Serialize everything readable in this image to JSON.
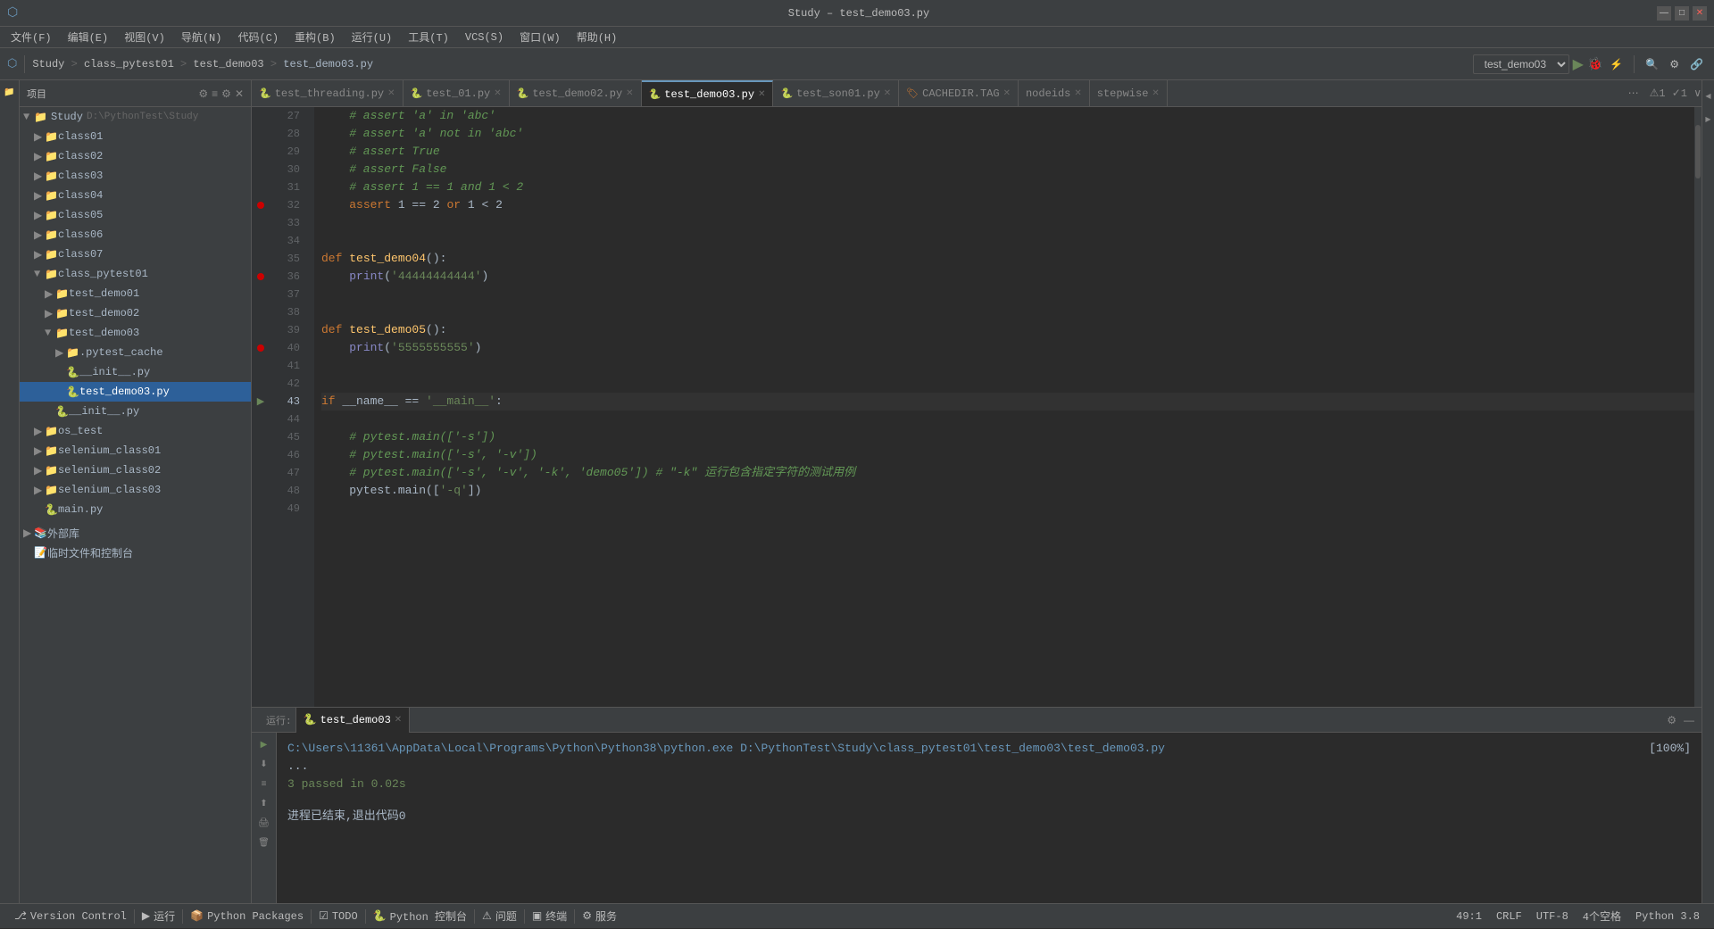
{
  "titlebar": {
    "title": "Study – test_demo03.py",
    "min": "—",
    "max": "□",
    "close": "✕"
  },
  "menubar": {
    "items": [
      "文件(F)",
      "编辑(E)",
      "视图(V)",
      "导航(N)",
      "代码(C)",
      "重构(B)",
      "运行(U)",
      "工具(T)",
      "VCS(S)",
      "窗口(W)",
      "帮助(H)"
    ]
  },
  "toolbar": {
    "project_label": "Study",
    "breadcrumb": [
      "Study",
      "class_pytest01",
      "test_demo03",
      "test_demo03.py"
    ],
    "run_config": "test_demo03",
    "run_label": "▶",
    "debug_label": "🐞"
  },
  "sidebar": {
    "header": "项目",
    "root": {
      "label": "Study",
      "path": "D:\\PythonTest\\Study"
    },
    "tree": [
      {
        "id": "class01",
        "label": "class01",
        "indent": 1,
        "type": "folder",
        "expanded": false
      },
      {
        "id": "class02",
        "label": "class02",
        "indent": 1,
        "type": "folder",
        "expanded": false
      },
      {
        "id": "class03",
        "label": "class03",
        "indent": 1,
        "type": "folder",
        "expanded": false
      },
      {
        "id": "class04",
        "label": "class04",
        "indent": 1,
        "type": "folder",
        "expanded": false
      },
      {
        "id": "class05",
        "label": "class05",
        "indent": 1,
        "type": "folder",
        "expanded": false
      },
      {
        "id": "class06",
        "label": "class06",
        "indent": 1,
        "type": "folder",
        "expanded": false
      },
      {
        "id": "class07",
        "label": "class07",
        "indent": 1,
        "type": "folder",
        "expanded": false
      },
      {
        "id": "class_pytest01",
        "label": "class_pytest01",
        "indent": 1,
        "type": "folder",
        "expanded": true
      },
      {
        "id": "test_demo01",
        "label": "test_demo01",
        "indent": 2,
        "type": "folder",
        "expanded": false
      },
      {
        "id": "test_demo02",
        "label": "test_demo02",
        "indent": 2,
        "type": "folder",
        "expanded": false
      },
      {
        "id": "test_demo03",
        "label": "test_demo03",
        "indent": 2,
        "type": "folder",
        "expanded": true
      },
      {
        "id": "pytest_cache",
        "label": ".pytest_cache",
        "indent": 3,
        "type": "folder",
        "expanded": false
      },
      {
        "id": "init_py",
        "label": "__init__.py",
        "indent": 3,
        "type": "py",
        "expanded": false
      },
      {
        "id": "test_demo03_py",
        "label": "test_demo03.py",
        "indent": 3,
        "type": "py",
        "expanded": false,
        "active": true
      },
      {
        "id": "init_py2",
        "label": "__init__.py",
        "indent": 2,
        "type": "py",
        "expanded": false
      },
      {
        "id": "os_test",
        "label": "os_test",
        "indent": 1,
        "type": "folder",
        "expanded": false
      },
      {
        "id": "selenium_class01",
        "label": "selenium_class01",
        "indent": 1,
        "type": "folder",
        "expanded": false
      },
      {
        "id": "selenium_class02",
        "label": "selenium_class02",
        "indent": 1,
        "type": "folder",
        "expanded": false
      },
      {
        "id": "selenium_class03",
        "label": "selenium_class03",
        "indent": 1,
        "type": "folder",
        "expanded": false
      },
      {
        "id": "main_py",
        "label": "main.py",
        "indent": 1,
        "type": "py",
        "expanded": false
      }
    ],
    "bottom": [
      {
        "id": "external",
        "label": "外部库",
        "icon": "📚"
      },
      {
        "id": "scratches",
        "label": "临时文件和控制台",
        "icon": "📝"
      }
    ]
  },
  "tabs": [
    {
      "id": "test_threading",
      "label": "test_threading.py",
      "active": false,
      "type": "py"
    },
    {
      "id": "test_01",
      "label": "test_01.py",
      "active": false,
      "type": "py"
    },
    {
      "id": "test_demo02",
      "label": "test_demo02.py",
      "active": false,
      "type": "py"
    },
    {
      "id": "test_demo03",
      "label": "test_demo03.py",
      "active": true,
      "type": "py"
    },
    {
      "id": "test_son01",
      "label": "test_son01.py",
      "active": false,
      "type": "py"
    },
    {
      "id": "CACHEDIR_TAG",
      "label": "CACHEDIR.TAG",
      "active": false,
      "type": "tag"
    },
    {
      "id": "nodeids",
      "label": "nodeids",
      "active": false,
      "type": "txt"
    },
    {
      "id": "stepwise",
      "label": "stepwise",
      "active": false,
      "type": "txt"
    }
  ],
  "code": {
    "lines": [
      {
        "num": 27,
        "content": "    # assert 'a' in 'abc'",
        "type": "comment"
      },
      {
        "num": 28,
        "content": "    # assert 'a' not in 'abc'",
        "type": "comment"
      },
      {
        "num": 29,
        "content": "    # assert True",
        "type": "comment"
      },
      {
        "num": 30,
        "content": "    # assert False",
        "type": "comment"
      },
      {
        "num": 31,
        "content": "    # assert 1 == 1 and 1 < 2",
        "type": "comment"
      },
      {
        "num": 32,
        "content": "    assert 1 == 2 or 1 < 2",
        "type": "code"
      },
      {
        "num": 33,
        "content": "",
        "type": "empty"
      },
      {
        "num": 34,
        "content": "",
        "type": "empty"
      },
      {
        "num": 35,
        "content": "def test_demo04():",
        "type": "code"
      },
      {
        "num": 36,
        "content": "    print('44444444444')",
        "type": "code"
      },
      {
        "num": 37,
        "content": "",
        "type": "empty"
      },
      {
        "num": 38,
        "content": "",
        "type": "empty"
      },
      {
        "num": 39,
        "content": "def test_demo05():",
        "type": "code"
      },
      {
        "num": 40,
        "content": "    print('5555555555')",
        "type": "code"
      },
      {
        "num": 41,
        "content": "",
        "type": "empty"
      },
      {
        "num": 42,
        "content": "",
        "type": "empty"
      },
      {
        "num": 43,
        "content": "if __name__ == '__main__':",
        "type": "code",
        "run_arrow": true
      },
      {
        "num": 44,
        "content": "",
        "type": "empty"
      },
      {
        "num": 45,
        "content": "    # pytest.main(['-s'])",
        "type": "comment"
      },
      {
        "num": 46,
        "content": "    # pytest.main(['-s', '-v'])",
        "type": "comment"
      },
      {
        "num": 47,
        "content": "    # pytest.main(['-s', '-v', '-k', 'demo05']) # \"-k\" 运行包含指定字符的测试用例",
        "type": "comment"
      },
      {
        "num": 48,
        "content": "    pytest.main(['-q'])",
        "type": "code"
      },
      {
        "num": 49,
        "content": "",
        "type": "empty"
      }
    ]
  },
  "terminal": {
    "title": "test_demo03",
    "command": "C:\\Users\\11361\\AppData\\Local\\Programs\\Python\\Python38\\python.exe D:\\PythonTest\\Study\\class_pytest01\\test_demo03\\test_demo03.py",
    "progress": "[100%]",
    "dots": "...",
    "result": "3 passed in 0.02s",
    "exit_msg": "进程已结束,退出代码0",
    "left_btns": [
      "▶",
      "⬇",
      "≡",
      "⬆",
      "🖨",
      "🗑"
    ]
  },
  "statusbar": {
    "left": [
      {
        "id": "vcs",
        "label": "Version Control",
        "icon": "⎇"
      },
      {
        "id": "run",
        "label": "运行",
        "icon": "▶"
      },
      {
        "id": "python_packages",
        "label": "Python Packages",
        "icon": "📦"
      },
      {
        "id": "todo",
        "label": "TODO",
        "icon": "☑"
      },
      {
        "id": "python_console",
        "label": "Python 控制台",
        "icon": "🐍"
      },
      {
        "id": "issues",
        "label": "问题",
        "icon": "⚠"
      },
      {
        "id": "terminal",
        "label": "终端",
        "icon": "▣"
      },
      {
        "id": "services",
        "label": "服务",
        "icon": "⚙"
      }
    ],
    "right": {
      "position": "49:1",
      "line_sep": "CRLF",
      "encoding": "UTF-8",
      "indent": "4个空格",
      "python": "Python 3.8"
    }
  }
}
